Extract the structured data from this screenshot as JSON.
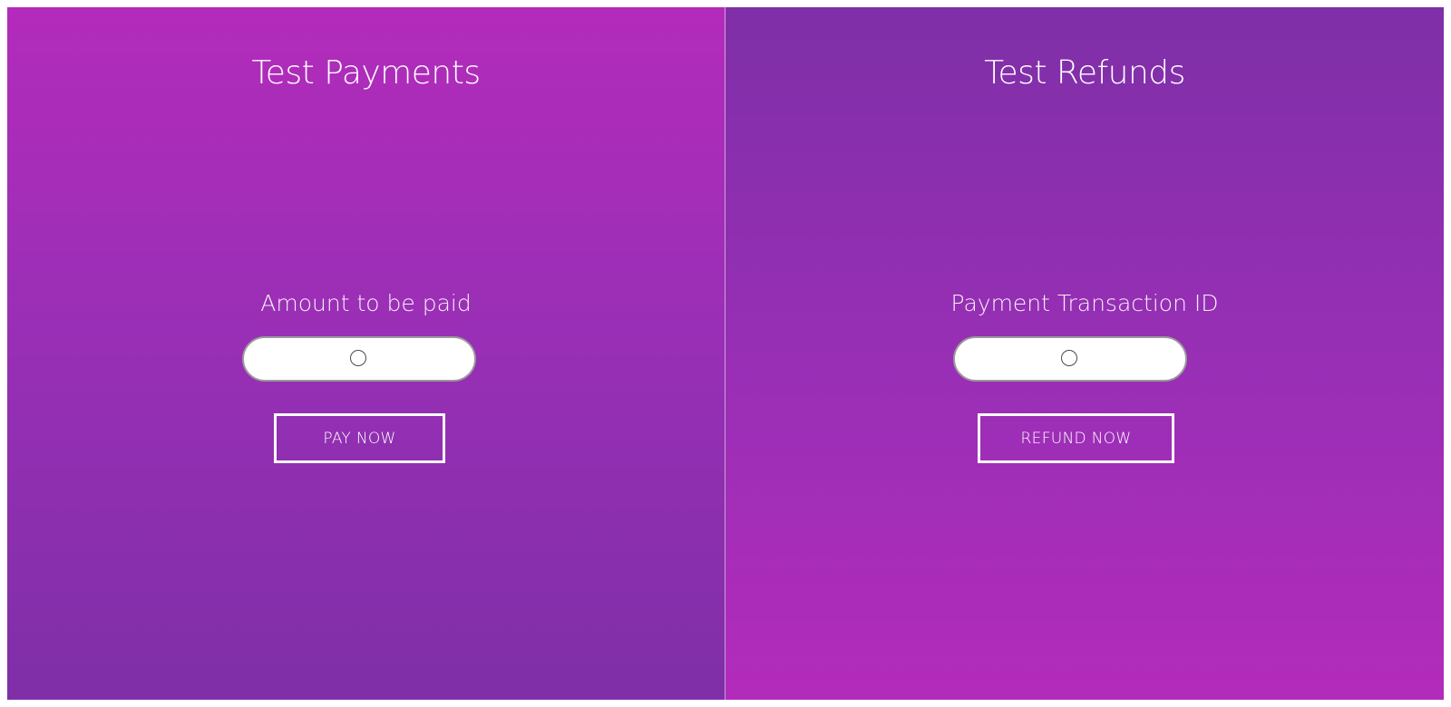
{
  "payments": {
    "title": "Test Payments",
    "field_label": "Amount to be paid",
    "input_value": "",
    "input_placeholder": "",
    "button_label": "PAY NOW"
  },
  "refunds": {
    "title": "Test Refunds",
    "field_label": "Payment Transaction ID",
    "input_value": "",
    "input_placeholder": "",
    "button_label": "REFUND NOW"
  },
  "colors": {
    "purple_light": "#b32bbb",
    "purple_dark": "#7f2fa8",
    "input_border": "#9a9a9a",
    "button_border": "#ffffff"
  }
}
